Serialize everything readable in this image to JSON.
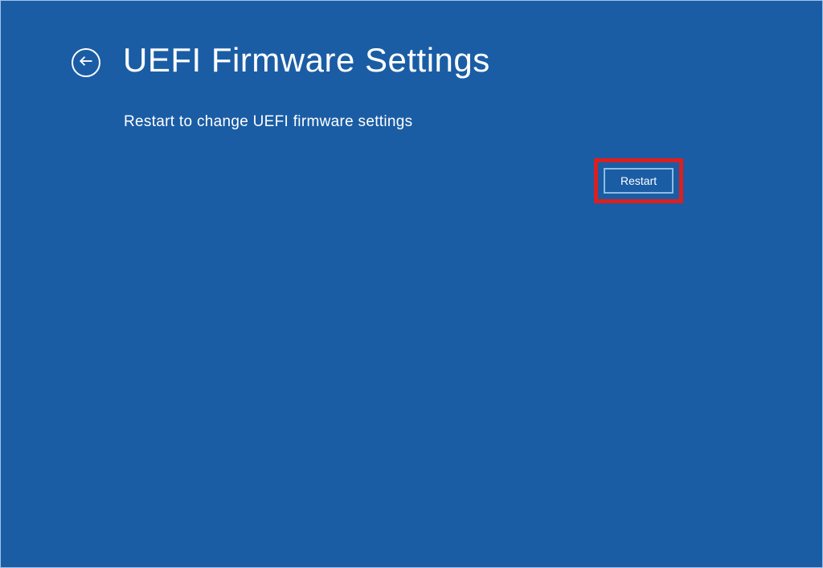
{
  "header": {
    "title": "UEFI Firmware Settings"
  },
  "main": {
    "description": "Restart to change UEFI firmware settings"
  },
  "actions": {
    "restart_label": "Restart"
  }
}
